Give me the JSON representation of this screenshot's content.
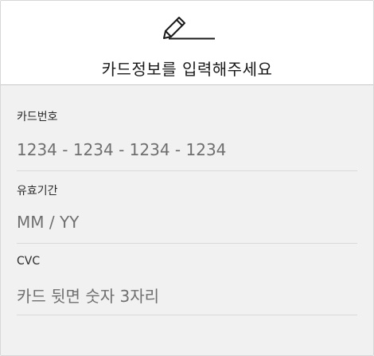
{
  "header": {
    "icon": "pencil-icon",
    "title": "카드정보를 입력해주세요"
  },
  "fields": {
    "card_number": {
      "label": "카드번호",
      "placeholder": "1234 - 1234 - 1234 - 1234"
    },
    "expiry": {
      "label": "유효기간",
      "placeholder": "MM / YY"
    },
    "cvc": {
      "label": "CVC",
      "placeholder": "카드 뒷면 숫자 3자리"
    }
  }
}
